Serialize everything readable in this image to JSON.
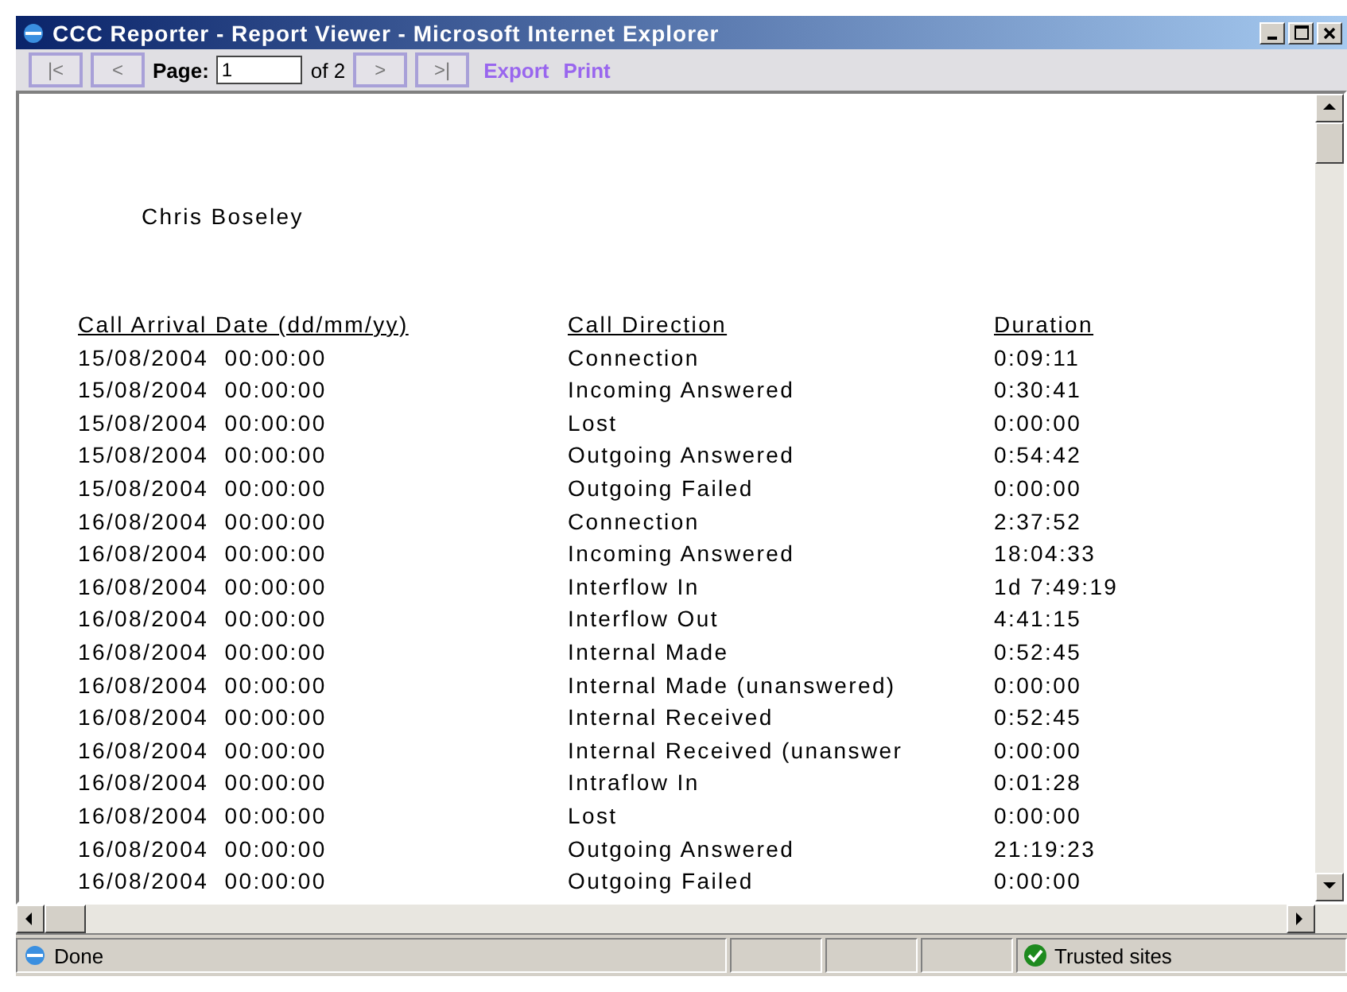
{
  "window": {
    "title": "CCC Reporter - Report Viewer - Microsoft Internet Explorer"
  },
  "toolbar": {
    "first": "|<",
    "previous": "<",
    "page_label": "Page:",
    "page_value": "1",
    "page_of": "of 2",
    "next": ">",
    "last": ">|",
    "links": [
      "Export",
      "Print"
    ]
  },
  "report": {
    "agent": "Chris Boseley",
    "table": {
      "columns": [
        "Call Arrival Date (dd/mm/yy)",
        "Call Direction",
        "Duration"
      ],
      "rows": [
        [
          "15/08/2004  00:00:00",
          "Connection",
          "0:09:11"
        ],
        [
          "15/08/2004  00:00:00",
          "Incoming Answered",
          "0:30:41"
        ],
        [
          "15/08/2004  00:00:00",
          "Lost",
          "0:00:00"
        ],
        [
          "15/08/2004  00:00:00",
          "Outgoing Answered",
          "0:54:42"
        ],
        [
          "15/08/2004  00:00:00",
          "Outgoing Failed",
          "0:00:00"
        ],
        [
          "16/08/2004  00:00:00",
          "Connection",
          "2:37:52"
        ],
        [
          "16/08/2004  00:00:00",
          "Incoming Answered",
          "18:04:33"
        ],
        [
          "16/08/2004  00:00:00",
          "Interflow In",
          "1d 7:49:19"
        ],
        [
          "16/08/2004  00:00:00",
          "Interflow Out",
          "4:41:15"
        ],
        [
          "16/08/2004  00:00:00",
          "Internal Made",
          "0:52:45"
        ],
        [
          "16/08/2004  00:00:00",
          "Internal Made (unanswered)",
          "0:00:00"
        ],
        [
          "16/08/2004  00:00:00",
          "Internal Received",
          "0:52:45"
        ],
        [
          "16/08/2004  00:00:00",
          "Internal Received (unanswer",
          "0:00:00"
        ],
        [
          "16/08/2004  00:00:00",
          "Intraflow In",
          "0:01:28"
        ],
        [
          "16/08/2004  00:00:00",
          "Lost",
          "0:00:00"
        ],
        [
          "16/08/2004  00:00:00",
          "Outgoing Answered",
          "21:19:23"
        ],
        [
          "16/08/2004  00:00:00",
          "Outgoing Failed",
          "0:00:00"
        ]
      ]
    }
  },
  "status_bar": {
    "status": "Done",
    "zone": "Trusted sites"
  }
}
